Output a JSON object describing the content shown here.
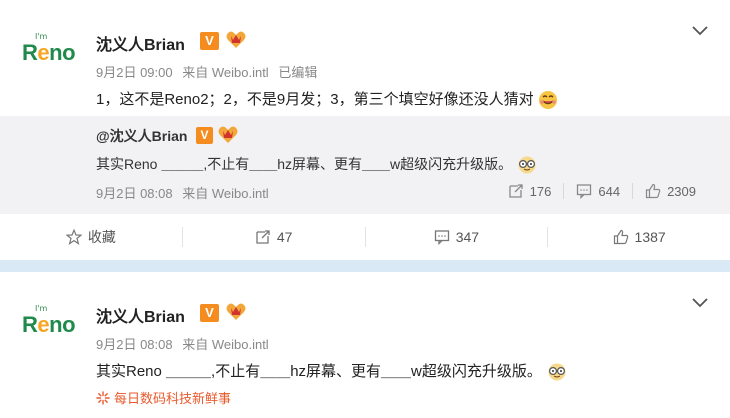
{
  "post1": {
    "author": "沈义人Brian",
    "v_badge": "V",
    "date": "9月2日 09:00",
    "via": "来自 Weibo.intl",
    "edited": "已编辑",
    "text": "1，这不是Reno2；2，不是9月发；3，第三个填空好像还没人猜对",
    "repost": {
      "author": "@沈义人Brian",
      "v_badge": "V",
      "text": "其实Reno ＿＿＿,不止有＿＿hz屏幕、更有＿＿w超级闪充升级版。",
      "date": "9月2日 08:08",
      "via": "来自 Weibo.intl",
      "reposts": "176",
      "comments": "644",
      "likes": "2309"
    },
    "actions": {
      "favorite": "收藏",
      "reposts": "47",
      "comments": "347",
      "likes": "1387"
    }
  },
  "post2": {
    "author": "沈义人Brian",
    "v_badge": "V",
    "date": "9月2日 08:08",
    "via": "来自 Weibo.intl",
    "text": "其实Reno ＿＿＿,不止有＿＿hz屏幕、更有＿＿w超级闪充升级版。",
    "source_tag": "每日数码科技新鲜事"
  },
  "avatar": {
    "im": "I'm",
    "brand_r": "R",
    "brand_e": "e",
    "brand_no": "no"
  },
  "colors": {
    "brand_green": "#1f8a4c",
    "badge_orange": "#f58c1f",
    "separator": "#d9eaf6",
    "source_red": "#e8592b"
  },
  "icons": [
    "chevron-down-icon",
    "star-icon",
    "repost-icon",
    "comment-icon",
    "like-icon",
    "vip-icon",
    "smile-emoji",
    "nerd-emoji",
    "sparkle-icon"
  ]
}
